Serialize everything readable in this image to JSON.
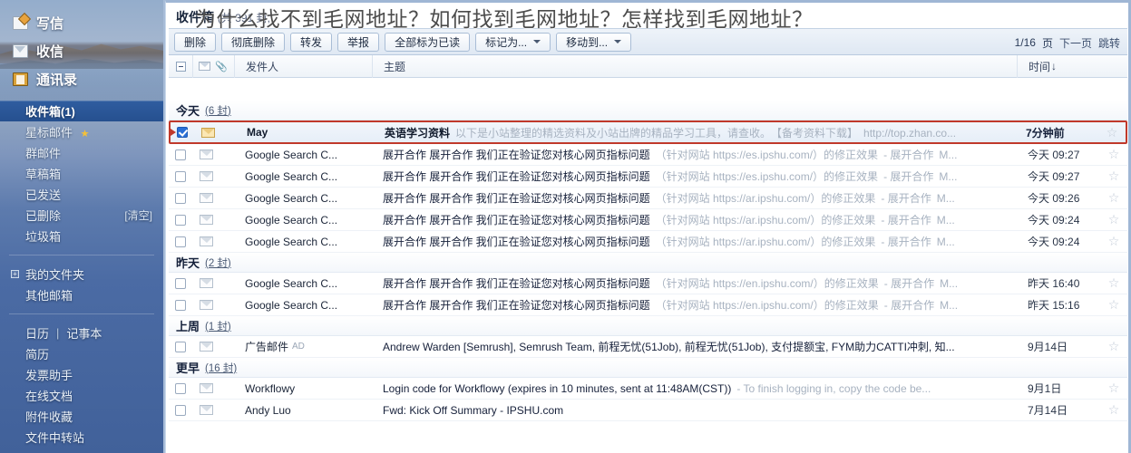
{
  "overlay": {
    "title": "为什么找不到毛网地址？如何找到毛网地址？怎样找到毛网地址？"
  },
  "sidebar": {
    "top_actions": [
      {
        "label": "写信",
        "icon": "compose-icon"
      },
      {
        "label": "收信",
        "icon": "receive-icon"
      },
      {
        "label": "通讯录",
        "icon": "contacts-icon"
      }
    ],
    "folders": [
      {
        "label": "收件箱(1)",
        "selected": true,
        "tail": "",
        "star": false
      },
      {
        "label": "星标邮件",
        "selected": false,
        "tail": "",
        "star": true
      },
      {
        "label": "群邮件",
        "selected": false,
        "tail": "",
        "star": false
      },
      {
        "label": "草稿箱",
        "selected": false,
        "tail": "",
        "star": false
      },
      {
        "label": "已发送",
        "selected": false,
        "tail": "",
        "star": false
      },
      {
        "label": "已删除",
        "selected": false,
        "tail": "[清空]",
        "star": false
      },
      {
        "label": "垃圾箱",
        "selected": false,
        "tail": "",
        "star": false
      }
    ],
    "my_folders": {
      "label": "我的文件夹",
      "expander": "+"
    },
    "other_mailbox": {
      "label": "其他邮箱"
    },
    "tools_dual": {
      "left": "日历",
      "divider": "|",
      "right": "记事本"
    },
    "tools": [
      {
        "label": "简历"
      },
      {
        "label": "发票助手"
      },
      {
        "label": "在线文档"
      },
      {
        "label": "附件收藏"
      },
      {
        "label": "文件中转站"
      }
    ]
  },
  "mailbox": {
    "title_main": "收件箱",
    "title_meta": "(共 391 封,"
  },
  "toolbar": {
    "buttons": [
      {
        "label": "删除",
        "caret": false
      },
      {
        "label": "彻底删除",
        "caret": false
      },
      {
        "label": "转发",
        "caret": false
      },
      {
        "label": "举报",
        "caret": false
      },
      {
        "label": "全部标为已读",
        "caret": false
      },
      {
        "label": "标记为...",
        "caret": true
      },
      {
        "label": "移动到...",
        "caret": true
      }
    ],
    "pager": {
      "page": "1/16",
      "page_unit": "页",
      "next": "下一页",
      "jump": "跳转"
    }
  },
  "columns": {
    "from": "发件人",
    "subject": "主题",
    "time": "时间",
    "sort_arrow": "↓"
  },
  "groups": [
    {
      "name": "今天",
      "count": "(6 封)",
      "rows": [
        {
          "selected": true,
          "checked": true,
          "unread": true,
          "from": "May",
          "subject": "英语学习资料",
          "snippet": "以下是小站整理的精选资料及小站出牌的精品学习工具，请查收。　【备考资料下载】　http://top.zhan.co...",
          "time": "7分钟前",
          "time_strong": true,
          "starred": false
        },
        {
          "selected": false,
          "checked": false,
          "unread": false,
          "from": "Google Search C...",
          "subject": "展开合作 展开合作  我们正在验证您对核心网页指标问题",
          "snippet": "（针对网站 https://es.ipshu.com/）的修正效果",
          "snippet2": "- 展开合作",
          "trail": "M...",
          "time": "今天 09:27",
          "time_strong": false,
          "starred": false
        },
        {
          "selected": false,
          "checked": false,
          "unread": false,
          "from": "Google Search C...",
          "subject": "展开合作 展开合作  我们正在验证您对核心网页指标问题",
          "snippet": "（针对网站 https://es.ipshu.com/）的修正效果",
          "snippet2": "- 展开合作",
          "trail": "M...",
          "time": "今天 09:27",
          "time_strong": false,
          "starred": false
        },
        {
          "selected": false,
          "checked": false,
          "unread": false,
          "from": "Google Search C...",
          "subject": "展开合作 展开合作  我们正在验证您对核心网页指标问题",
          "snippet": "（针对网站 https://ar.ipshu.com/）的修正效果",
          "snippet2": "- 展开合作",
          "trail": "M...",
          "time": "今天 09:26",
          "time_strong": false,
          "starred": false
        },
        {
          "selected": false,
          "checked": false,
          "unread": false,
          "from": "Google Search C...",
          "subject": "展开合作 展开合作  我们正在验证您对核心网页指标问题",
          "snippet": "（针对网站 https://ar.ipshu.com/）的修正效果",
          "snippet2": "- 展开合作",
          "trail": "M...",
          "time": "今天 09:24",
          "time_strong": false,
          "starred": false
        },
        {
          "selected": false,
          "checked": false,
          "unread": false,
          "from": "Google Search C...",
          "subject": "展开合作 展开合作  我们正在验证您对核心网页指标问题",
          "snippet": "（针对网站 https://ar.ipshu.com/）的修正效果",
          "snippet2": "- 展开合作",
          "trail": "M...",
          "time": "今天 09:24",
          "time_strong": false,
          "starred": false
        }
      ]
    },
    {
      "name": "昨天",
      "count": "(2 封)",
      "rows": [
        {
          "selected": false,
          "checked": false,
          "unread": false,
          "from": "Google Search C...",
          "subject": "展开合作 展开合作  我们正在验证您对核心网页指标问题",
          "snippet": "（针对网站 https://en.ipshu.com/）的修正效果",
          "snippet2": "- 展开合作",
          "trail": "M...",
          "time": "昨天 16:40",
          "time_strong": false,
          "starred": false
        },
        {
          "selected": false,
          "checked": false,
          "unread": false,
          "from": "Google Search C...",
          "subject": "展开合作 展开合作  我们正在验证您对核心网页指标问题",
          "snippet": "（针对网站 https://en.ipshu.com/）的修正效果",
          "snippet2": "- 展开合作",
          "trail": "M...",
          "time": "昨天 15:16",
          "time_strong": false,
          "starred": false
        }
      ]
    },
    {
      "name": "上周",
      "count": "(1 封)",
      "rows": [
        {
          "selected": false,
          "checked": false,
          "unread": false,
          "from": "广告邮件",
          "from_tag": "AD",
          "subject": "Andrew Warden [Semrush], Semrush Team, 前程无忧(51Job), 前程无忧(51Job), 支付提额宝, FYM助力CATTI冲刺, 知...",
          "snippet": "",
          "time": "9月14日",
          "time_strong": false,
          "starred": false
        }
      ]
    },
    {
      "name": "更早",
      "count": "(16 封)",
      "rows": [
        {
          "selected": false,
          "checked": false,
          "unread": false,
          "from": "Workflowy",
          "subject": "Login code for Workflowy (expires in 10 minutes, sent at 11:48AM(CST))",
          "snippet": "- To finish logging in, copy the code be...",
          "time": "9月1日",
          "time_strong": false,
          "starred": false
        },
        {
          "selected": false,
          "checked": false,
          "unread": false,
          "from": "Andy Luo",
          "subject": "Fwd: Kick Off Summary - IPSHU.com",
          "snippet": "",
          "time": "7月14日",
          "time_strong": false,
          "starred": false
        }
      ]
    }
  ]
}
